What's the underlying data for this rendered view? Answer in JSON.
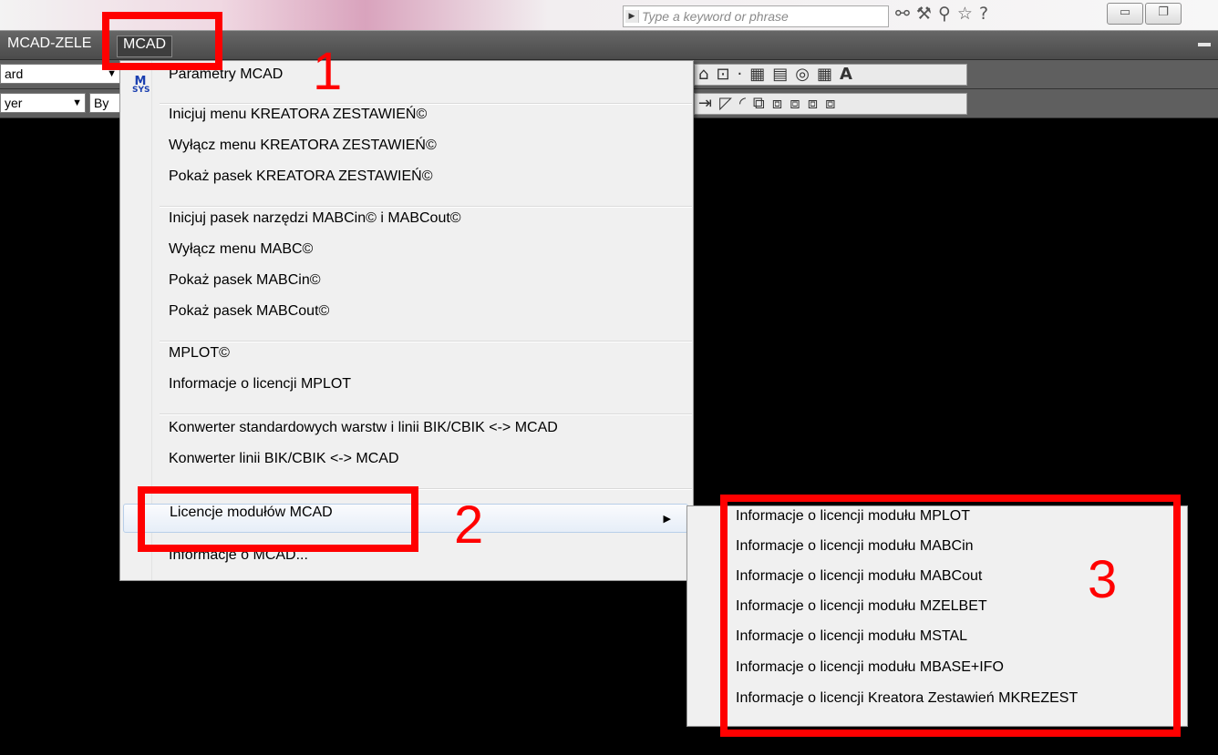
{
  "search": {
    "placeholder": "Type a keyword or phrase"
  },
  "title_icons": {
    "binoculars": "binoculars-icon",
    "tools": "tools-icon",
    "network": "network-icon",
    "star": "star-icon",
    "help": "help-icon"
  },
  "menubar": {
    "items": [
      {
        "label": "MCAD-ZELE"
      },
      {
        "label": "MCAD"
      }
    ]
  },
  "toolbar": {
    "style_combo": "ard",
    "layer_combo": "yer",
    "bylayer_combo": "By",
    "text_icon_glyph": "A"
  },
  "menu": {
    "items": [
      {
        "label": "Parametry MCAD",
        "icon": "msys-icon",
        "icon_text_top": "M",
        "icon_text_bottom": "SYS"
      },
      {
        "label": "Inicjuj menu KREATORA ZESTAWIEŃ©"
      },
      {
        "label": "Wyłącz menu KREATORA ZESTAWIEŃ©"
      },
      {
        "label": "Pokaż pasek KREATORA ZESTAWIEŃ©"
      },
      {
        "label": "Inicjuj pasek narzędzi MABCin© i MABCout©"
      },
      {
        "label": "Wyłącz menu MABC©"
      },
      {
        "label": "Pokaż pasek MABCin©"
      },
      {
        "label": "Pokaż pasek MABCout©"
      },
      {
        "label": "MPLOT©"
      },
      {
        "label": "Informacje o licencji MPLOT"
      },
      {
        "label": "Konwerter standardowych warstw i linii BIK/CBIK <-> MCAD"
      },
      {
        "label": "Konwerter linii BIK/CBIK <-> MCAD"
      },
      {
        "label": "Licencje modułów MCAD"
      },
      {
        "label": "Informacje o MCAD..."
      }
    ]
  },
  "submenu": {
    "items": [
      {
        "label": "Informacje o licencji modułu MPLOT"
      },
      {
        "label": "Informacje o licencji modułu MABCin"
      },
      {
        "label": "Informacje o licencji modułu MABCout"
      },
      {
        "label": "Informacje o licencji modułu MZELBET"
      },
      {
        "label": "Informacje o licencji modułu MSTAL"
      },
      {
        "label": "Informacje o licencji modułu MBASE+IFO"
      },
      {
        "label": "Informacje o licencji Kreatora Zestawień MKREZEST"
      }
    ]
  },
  "annotations": {
    "step1": "1",
    "step2": "2",
    "step3": "3",
    "color": "#ff0000"
  }
}
